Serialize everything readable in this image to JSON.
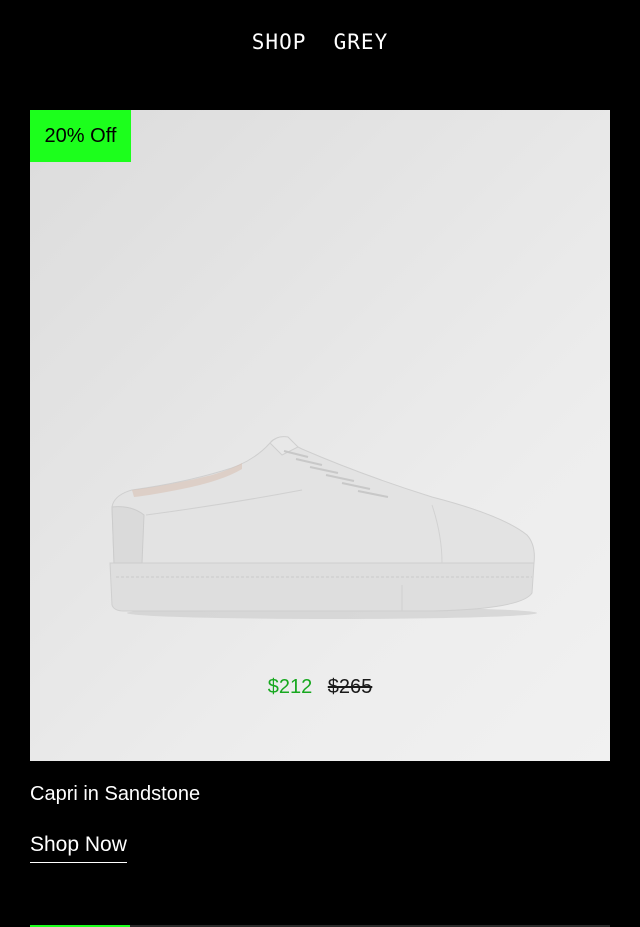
{
  "header": {
    "title": "SHOP  GREY"
  },
  "product": {
    "badge": "20% Off",
    "image_icon": "sneaker-image",
    "price_sale": "$212",
    "price_original": "$265",
    "name": "Capri in Sandstone",
    "cta_label": "Shop Now"
  },
  "colors": {
    "background": "#000000",
    "badge": "#1cff1c",
    "sale_price": "#17a81f"
  }
}
